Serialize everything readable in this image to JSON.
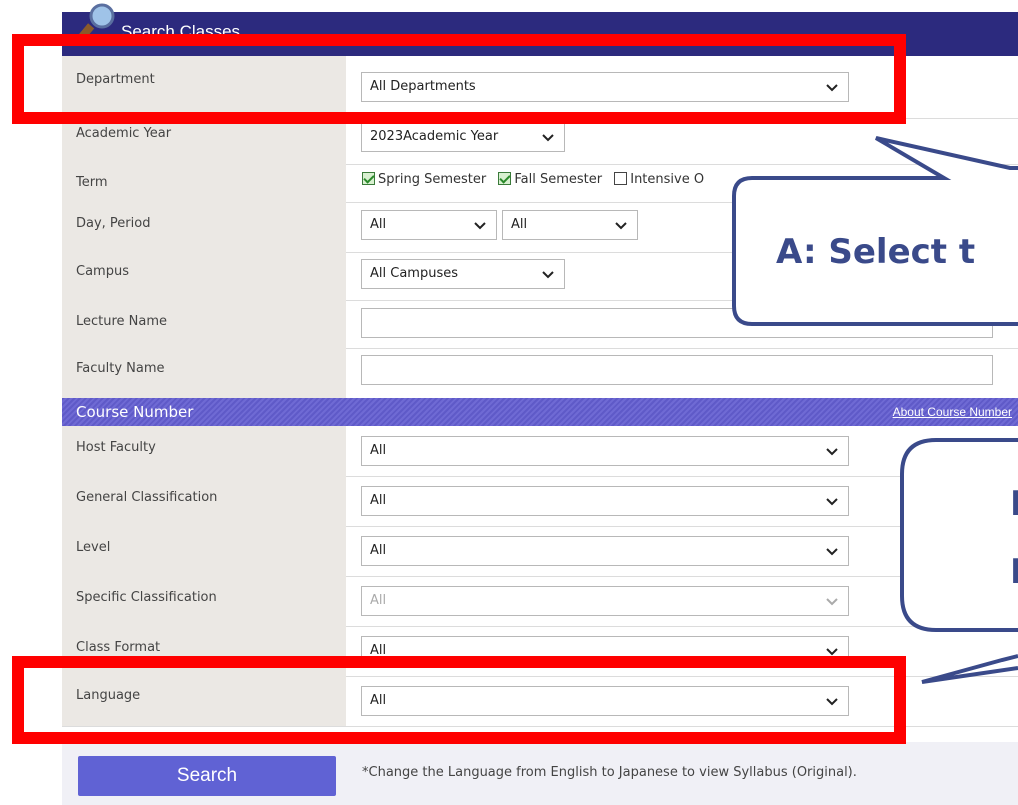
{
  "header": {
    "title": "Search Classes"
  },
  "fields": {
    "department": {
      "label": "Department",
      "value": "All Departments"
    },
    "academic_year": {
      "label": "Academic Year",
      "value": "2023Academic Year"
    },
    "term": {
      "label": "Term",
      "options": [
        {
          "label": "Spring Semester",
          "checked": true
        },
        {
          "label": "Fall Semester",
          "checked": true
        },
        {
          "label": "Intensive O",
          "checked": false
        }
      ]
    },
    "day_period": {
      "label": "Day, Period",
      "day_value": "All",
      "period_value": "All"
    },
    "campus": {
      "label": "Campus",
      "value": "All Campuses"
    },
    "lecture_name": {
      "label": "Lecture Name",
      "value": ""
    },
    "faculty_name": {
      "label": "Faculty Name",
      "value": ""
    }
  },
  "course_number": {
    "title": "Course Number",
    "link": "About Course Number",
    "host_faculty": {
      "label": "Host Faculty",
      "value": "All"
    },
    "general_classification": {
      "label": "General Classification",
      "value": "All"
    },
    "level": {
      "label": "Level",
      "value": "All"
    },
    "specific_classification": {
      "label": "Specific Classification",
      "value": "All"
    },
    "class_format": {
      "label": "Class Format",
      "value": "All"
    },
    "language": {
      "label": "Language",
      "value": "All"
    }
  },
  "actions": {
    "search_label": "Search",
    "note": "*Change the Language from English to Japanese to view Syllabus (Original)."
  },
  "annotations": {
    "callout_a": "A: Select t",
    "callout_b_line1": "I",
    "callout_b_line2": "I"
  },
  "colors": {
    "header_bg": "#2c2a7e",
    "course_number_bar": "#6560cc",
    "highlight_red": "#ff0000",
    "callout_border": "#3a4a8a",
    "search_button": "#6062d4"
  }
}
